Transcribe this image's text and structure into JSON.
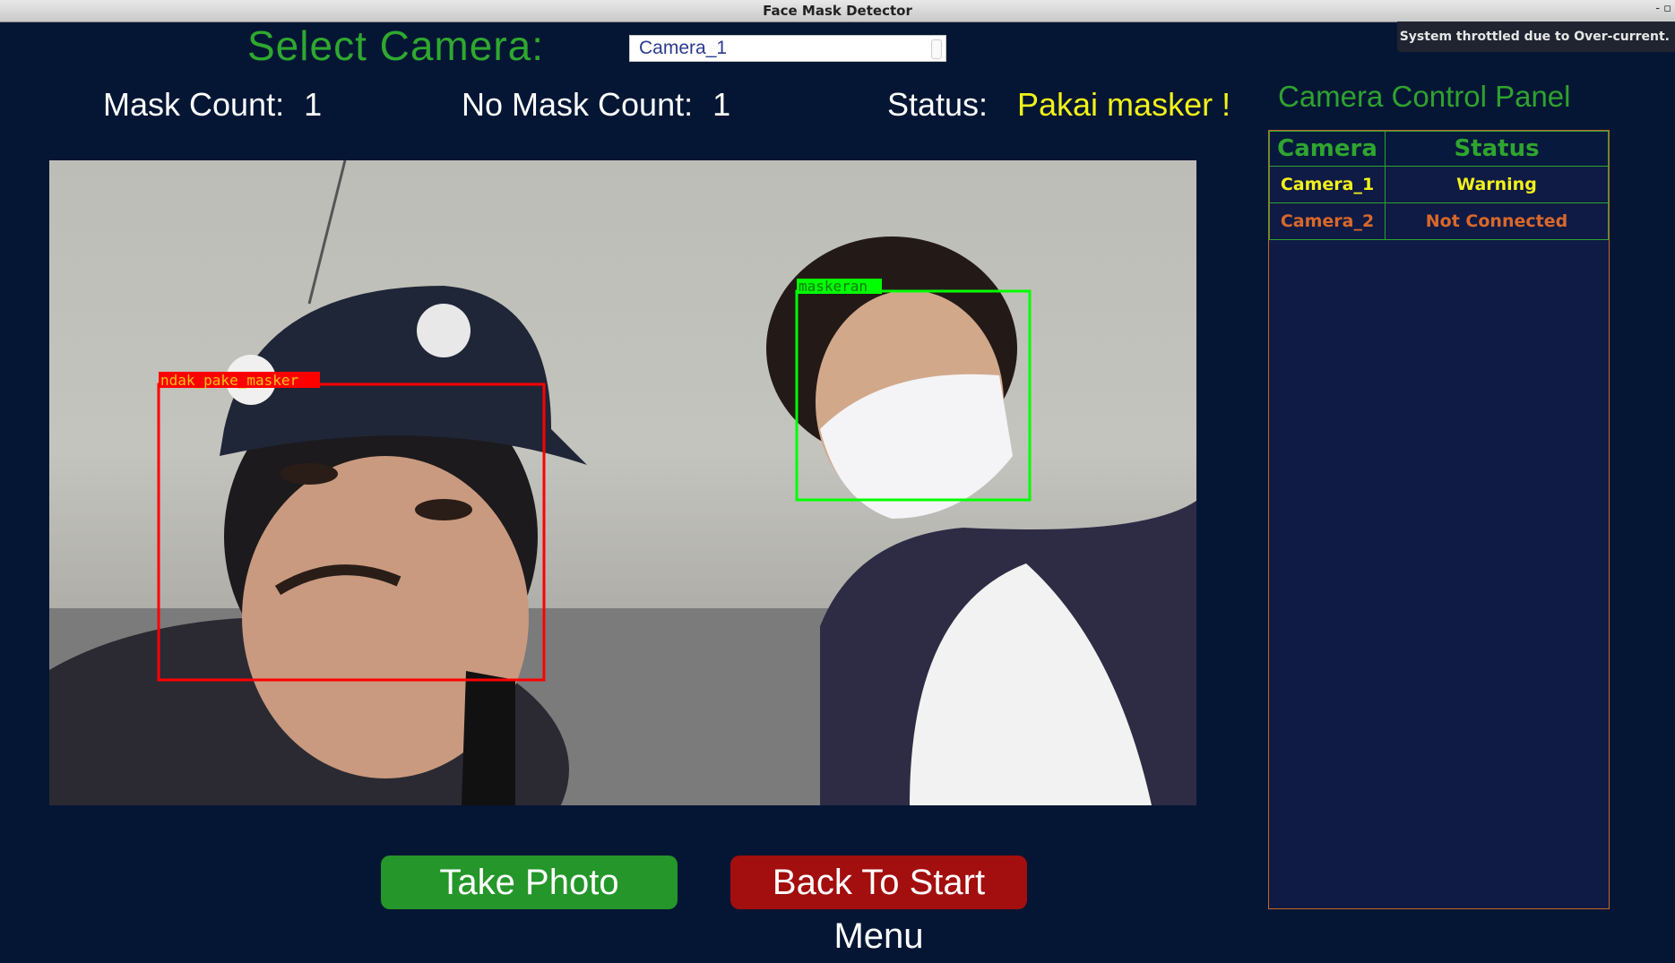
{
  "window": {
    "title": "Face Mask Detector",
    "controls": "- ▫"
  },
  "notification": "System throttled due to Over-current.",
  "camera_select": {
    "label": "Select Camera:",
    "selected": "Camera_1"
  },
  "counts": {
    "mask_label": "Mask Count:",
    "mask_value": "1",
    "no_mask_label": "No Mask Count:",
    "no_mask_value": "1",
    "status_label": "Status:",
    "status_value": "Pakai masker !"
  },
  "detections": [
    {
      "label": "ndak_pake_masker",
      "color": "#ff0000"
    },
    {
      "label": "maskeran",
      "color": "#00ff00"
    }
  ],
  "buttons": {
    "take_photo": "Take Photo",
    "back_to_start": "Back To Start Menu"
  },
  "panel": {
    "title": "Camera Control Panel",
    "headers": [
      "Camera",
      "Status"
    ],
    "rows": [
      {
        "camera": "Camera_1",
        "status": "Warning",
        "color": "#f2f219"
      },
      {
        "camera": "Camera_2",
        "status": "Not Connected",
        "color": "#d9682a"
      }
    ]
  },
  "colors": {
    "background": "#051634",
    "accent_green": "#2fa82f",
    "button_green": "#25962a",
    "button_red": "#a30e0e",
    "status_yellow": "#f2f219"
  }
}
